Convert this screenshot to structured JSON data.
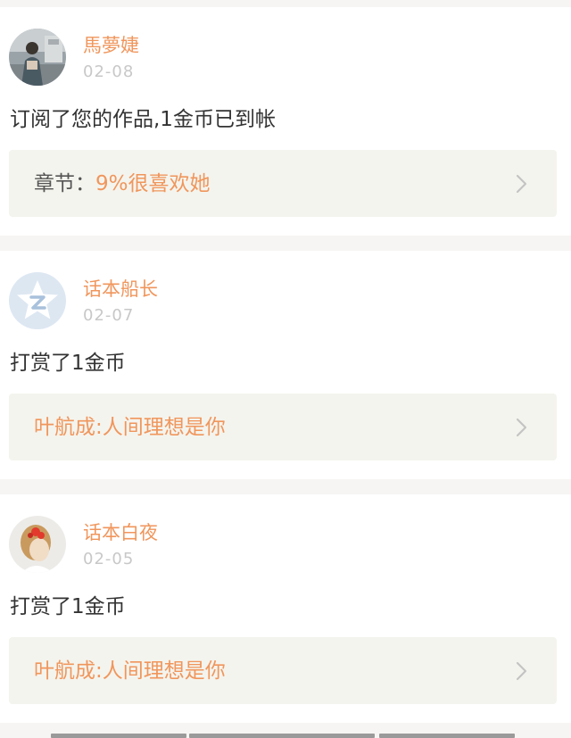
{
  "notifications": [
    {
      "avatar_icon": "user-photo-avatar",
      "user": "馬夢婕",
      "date": "02-08",
      "message": "订阅了您的作品,1金币已到帐",
      "link_prefix": "章节：",
      "link_text": "9%很喜欢她"
    },
    {
      "avatar_icon": "default-star-avatar",
      "user": "话本船长",
      "date": "02-07",
      "message": "打赏了1金币",
      "link_prefix": "",
      "link_text": "叶航成:人间理想是你"
    },
    {
      "avatar_icon": "user-photo-avatar",
      "user": "话本白夜",
      "date": "02-05",
      "message": "打赏了1金币",
      "link_prefix": "",
      "link_text": "叶航成:人间理想是你"
    }
  ],
  "colors": {
    "accent": "#f0965c",
    "date": "#c8c8c8",
    "text": "#333333",
    "box_bg": "#f4f4ee",
    "page_bg": "#f7f5f3"
  }
}
